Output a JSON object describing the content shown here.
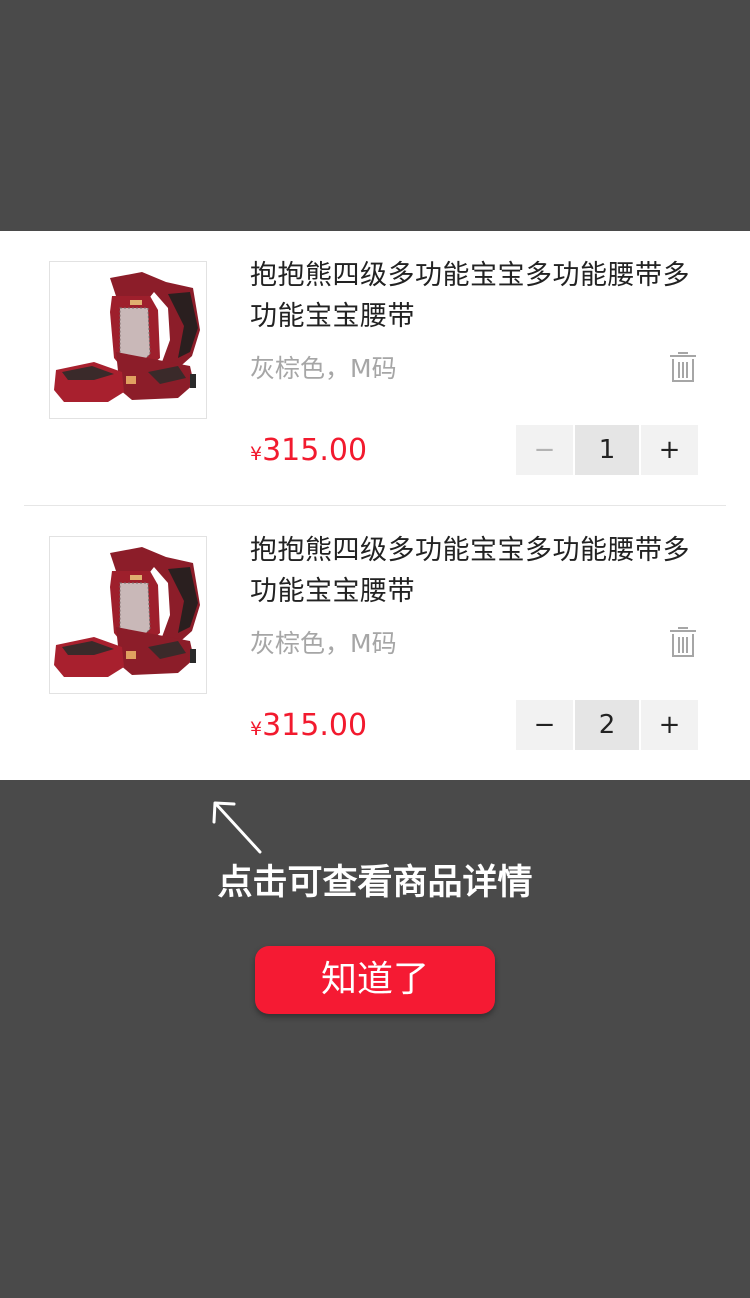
{
  "cart": {
    "items": [
      {
        "title": "抱抱熊四级多功能宝宝多功能腰带多功能宝宝腰带",
        "variant": "灰棕色，M码",
        "currency": "¥",
        "price": "315.00",
        "quantity": "1",
        "minus_label": "−",
        "plus_label": "+",
        "minus_disabled": true
      },
      {
        "title": "抱抱熊四级多功能宝宝多功能腰带多功能宝宝腰带",
        "variant": "灰棕色，M码",
        "currency": "¥",
        "price": "315.00",
        "quantity": "2",
        "minus_label": "−",
        "plus_label": "+",
        "minus_disabled": false
      }
    ]
  },
  "guide": {
    "hint": "点击可查看商品详情",
    "button_label": "知道了"
  },
  "colors": {
    "overlay": "#4a4a4a",
    "accent": "#f51a33",
    "price": "#f21a2e",
    "muted_text": "#a6a6a6",
    "product": "#9e1f2c"
  },
  "icons": {
    "delete": "trash-icon",
    "pointer": "arrow-up-left-icon"
  }
}
